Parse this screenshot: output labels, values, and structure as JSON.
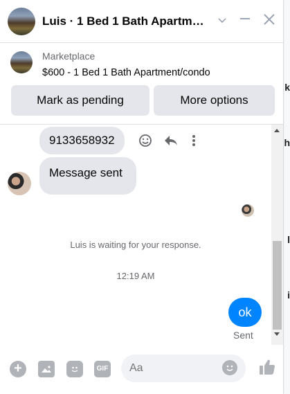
{
  "header": {
    "title": "Luis · 1 Bed 1 Bath Apartm…"
  },
  "product": {
    "label": "Marketplace",
    "title": "$600 - 1 Bed 1 Bath Apartment/condo",
    "buttons": {
      "mark_pending": "Mark as pending",
      "more_options": "More options"
    }
  },
  "messages": [
    {
      "text": "9133658932"
    },
    {
      "text": "Message sent"
    }
  ],
  "status": {
    "waiting": "Luis is waiting for your response.",
    "time": "12:19 AM"
  },
  "outgoing": {
    "text": "ok",
    "receipt": "Sent"
  },
  "composer": {
    "placeholder": "Aa",
    "gif_label": "GIF"
  },
  "background_fragments": [
    "k",
    "h",
    "l",
    "i"
  ],
  "colors": {
    "accent": "#0084ff",
    "bubble_in": "#e4e6eb",
    "button_bg": "#e4e6eb"
  }
}
